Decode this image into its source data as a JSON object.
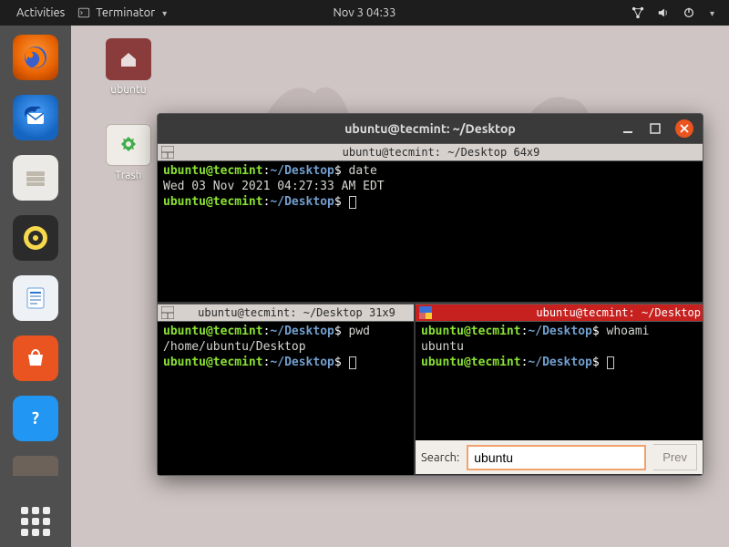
{
  "topbar": {
    "activities": "Activities",
    "app_name": "Terminator",
    "clock": "Nov 3  04:33"
  },
  "desktop_icons": {
    "home": "ubuntu",
    "trash": "Trash"
  },
  "dock": {
    "items": [
      "firefox",
      "thunderbird",
      "files",
      "rhythmbox",
      "writer",
      "software",
      "help",
      "disks"
    ]
  },
  "window": {
    "title": "ubuntu@tecmint: ~/Desktop",
    "panes": {
      "top": {
        "tab": "ubuntu@tecmint: ~/Desktop 64x9",
        "cmd1": "date",
        "out1": "Wed 03 Nov 2021 04:27:33 AM EDT"
      },
      "bottom_left": {
        "tab": "ubuntu@tecmint: ~/Desktop 31x9",
        "cmd1": "pwd",
        "out1": "/home/ubuntu/Desktop"
      },
      "bottom_right": {
        "tab": "ubuntu@tecmint: ~/Desktop",
        "cmd1": "whoami",
        "out1": "ubuntu"
      }
    },
    "prompt": {
      "user": "ubuntu",
      "at": "@",
      "host": "tecmint",
      "colon": ":",
      "path": "~/Desktop",
      "dollar": "$"
    },
    "search": {
      "label": "Search:",
      "value": "ubuntu",
      "prev": "Prev"
    }
  }
}
